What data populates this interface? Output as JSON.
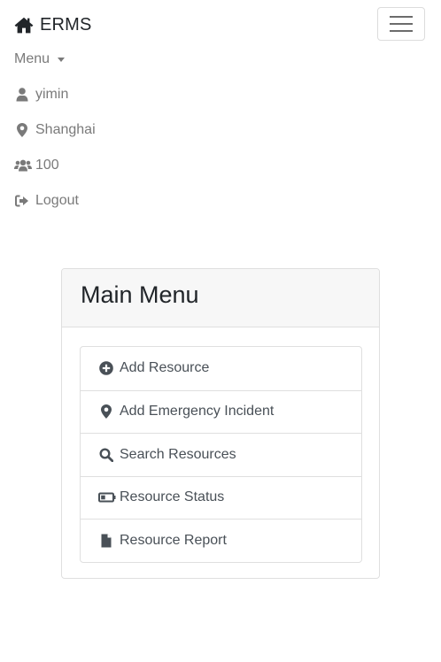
{
  "navbar": {
    "brand": {
      "label": "ERMS",
      "icon": "home-icon"
    },
    "toggler": {
      "icon": "hamburger-icon"
    },
    "items": [
      {
        "label": "Menu",
        "icon": "caret-down-icon"
      },
      {
        "label": "yimin",
        "icon": "user-icon"
      },
      {
        "label": "Shanghai",
        "icon": "map-marker-icon"
      },
      {
        "label": "100",
        "icon": "users-icon"
      },
      {
        "label": "Logout",
        "icon": "sign-out-icon"
      }
    ]
  },
  "main_menu": {
    "title": "Main Menu",
    "items": [
      {
        "label": "Add Resource",
        "icon": "plus-circle-icon"
      },
      {
        "label": "Add Emergency Incident",
        "icon": "map-marker-icon"
      },
      {
        "label": "Search Resources",
        "icon": "search-icon"
      },
      {
        "label": "Resource Status",
        "icon": "battery-icon"
      },
      {
        "label": "Resource Report",
        "icon": "file-icon"
      }
    ]
  },
  "colors": {
    "text_dark": "#212529",
    "nav_text": "#7a7a7a",
    "list_text": "#495057",
    "border": "#dfdfdf",
    "card_header_bg": "#f7f7f7"
  }
}
